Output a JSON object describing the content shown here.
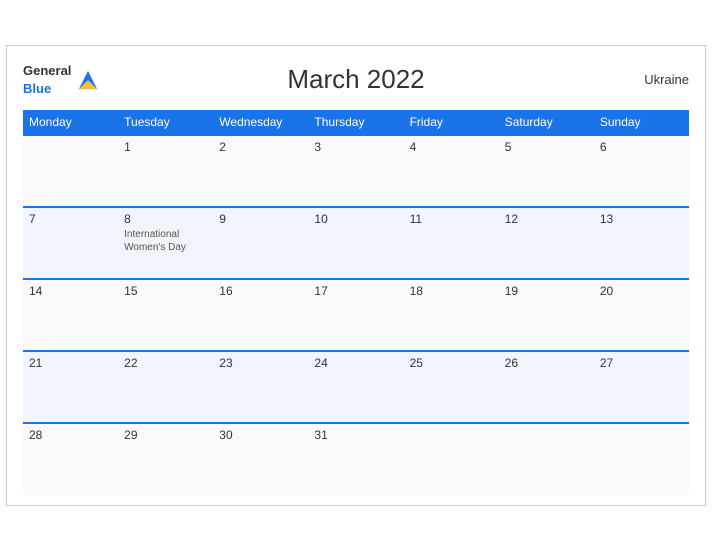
{
  "header": {
    "title": "March 2022",
    "country": "Ukraine",
    "logo_general": "General",
    "logo_blue": "Blue"
  },
  "days_of_week": [
    "Monday",
    "Tuesday",
    "Wednesday",
    "Thursday",
    "Friday",
    "Saturday",
    "Sunday"
  ],
  "weeks": [
    [
      {
        "day": "",
        "event": ""
      },
      {
        "day": "1",
        "event": ""
      },
      {
        "day": "2",
        "event": ""
      },
      {
        "day": "3",
        "event": ""
      },
      {
        "day": "4",
        "event": ""
      },
      {
        "day": "5",
        "event": ""
      },
      {
        "day": "6",
        "event": ""
      }
    ],
    [
      {
        "day": "7",
        "event": ""
      },
      {
        "day": "8",
        "event": "International Women's Day"
      },
      {
        "day": "9",
        "event": ""
      },
      {
        "day": "10",
        "event": ""
      },
      {
        "day": "11",
        "event": ""
      },
      {
        "day": "12",
        "event": ""
      },
      {
        "day": "13",
        "event": ""
      }
    ],
    [
      {
        "day": "14",
        "event": ""
      },
      {
        "day": "15",
        "event": ""
      },
      {
        "day": "16",
        "event": ""
      },
      {
        "day": "17",
        "event": ""
      },
      {
        "day": "18",
        "event": ""
      },
      {
        "day": "19",
        "event": ""
      },
      {
        "day": "20",
        "event": ""
      }
    ],
    [
      {
        "day": "21",
        "event": ""
      },
      {
        "day": "22",
        "event": ""
      },
      {
        "day": "23",
        "event": ""
      },
      {
        "day": "24",
        "event": ""
      },
      {
        "day": "25",
        "event": ""
      },
      {
        "day": "26",
        "event": ""
      },
      {
        "day": "27",
        "event": ""
      }
    ],
    [
      {
        "day": "28",
        "event": ""
      },
      {
        "day": "29",
        "event": ""
      },
      {
        "day": "30",
        "event": ""
      },
      {
        "day": "31",
        "event": ""
      },
      {
        "day": "",
        "event": ""
      },
      {
        "day": "",
        "event": ""
      },
      {
        "day": "",
        "event": ""
      }
    ]
  ]
}
